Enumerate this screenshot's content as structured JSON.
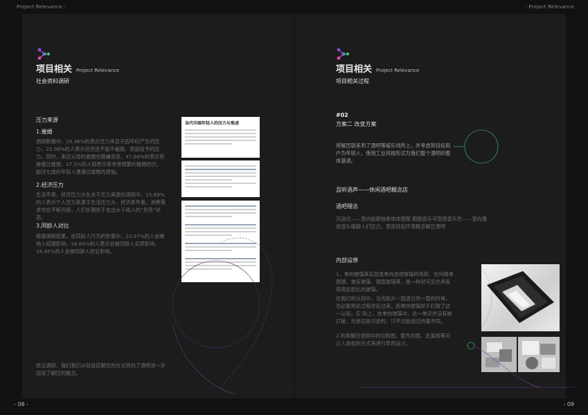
{
  "header": {
    "left": "Project Relevance -",
    "right": "- Project Relevance"
  },
  "page_numbers": {
    "left": "- 08 -",
    "right": "- 09"
  },
  "left_page": {
    "title": "项目相关",
    "title_en": "Project Relevance",
    "subtitle": "社会资料调研",
    "section_heading": "压力来源",
    "items": [
      {
        "heading": "1.催婚",
        "body": "调研数据中，26.36%的表示压力来自于因年纪产生的压力，25.98%的人表示迟迟还不能不裁婚，家庭给予的压力。同时，来自父母的催婚也跟嫌而至，47.68%的表示有被催过催婚，27.5%的人则表示有非常频繁的催婚经历，超过七成的年轻人遭遇过催婚的烦恼。"
      },
      {
        "heading": "2.经济压力",
        "body": "生活不易，经济压力大在关于压力来源的调研中，15.89%的人表示个人压力来源于生活压力大、经济条件差。消费需求也在不断升级，人们长期处于支出大于收入的“负债”状态。"
      },
      {
        "heading": "3.同龄人对比",
        "body": "根据调研结果，在同龄人行为的影像中，23.97%的人会被他人结婚影响，16.64%的人表示会被同龄人买房影响，16.45%的人会被同龄人创业影响。"
      }
    ],
    "conclusion": "经过调研，我们我们从轻食店解压的方式转向了酒吧进一步加深了解压的概念。",
    "news_title": "当代中国年轻人的压力与焦虑"
  },
  "right_page": {
    "title": "项目相关",
    "title_en": "Project Relevance",
    "subtitle": "项目相关过程",
    "number": "#02",
    "plan": "方案二  改变方案",
    "plan_body": "将解压联系到了酒吧等娱乐场所上，并考虑到目标用户为年轻人，使用工业风格形式为我们整个酒吧的整体基调。",
    "bar_name": "且听酒声——休闲酒吧概念店",
    "concept_heading": "酒吧理念",
    "concept_body": "沉浸式——室内投屏独奏体体图案 跟随音乐可变换音乐性——室内播放音乐缓解人们压力，营造轻松环境概念解压酒吧",
    "interior_heading": "内部设想",
    "interior_paragraphs": [
      "1、单向玻璃其实就是单向透视玻璃的简称，也叫做单面镜、单反玻璃、镜面玻璃等，是一种对可见光具有很高反射比的玻璃。",
      "在我们的认知中，当光能从一面透过另一面的时候，也必能将此过程逆反过来。而单向玻璃却于打破了这一认知。实·际上，在单向玻璃中，这一单识并没有被打破，光依旧是可逆的，只不过能透过的量不同。",
      "2.利用解压视频中的切割图，整齐的面，史莱姆等可让人放松的方式来进行导视设计。"
    ]
  },
  "colors": {
    "background": "#111111",
    "panel": "#1c1c1c",
    "accent_green": "#3fd07a",
    "accent_purple": "#8a4dd6",
    "accent_pink": "#e04aa0"
  }
}
